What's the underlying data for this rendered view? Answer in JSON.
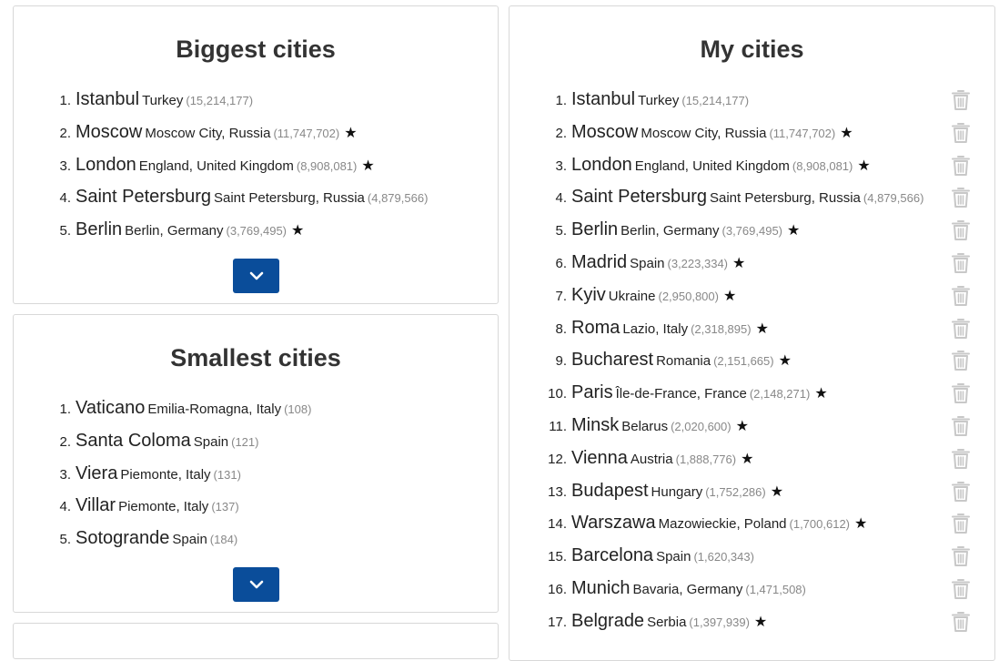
{
  "biggest": {
    "title": "Biggest cities",
    "cities": [
      {
        "num": "1.",
        "name": "Istanbul",
        "region": "Turkey",
        "pop": "(15,214,177)",
        "star": ""
      },
      {
        "num": "2.",
        "name": "Moscow",
        "region": "Moscow City, Russia",
        "pop": "(11,747,702)",
        "star": "★"
      },
      {
        "num": "3.",
        "name": "London",
        "region": "England, United Kingdom",
        "pop": "(8,908,081)",
        "star": "★"
      },
      {
        "num": "4.",
        "name": "Saint Petersburg",
        "region": "Saint Petersburg, Russia",
        "pop": "(4,879,566)",
        "star": ""
      },
      {
        "num": "5.",
        "name": "Berlin",
        "region": "Berlin, Germany",
        "pop": "(3,769,495)",
        "star": "★"
      }
    ],
    "expand_icon": "chevron-down-icon"
  },
  "smallest": {
    "title": "Smallest cities",
    "cities": [
      {
        "num": "1.",
        "name": "Vaticano",
        "region": "Emilia-Romagna, Italy",
        "pop": "(108)",
        "star": ""
      },
      {
        "num": "2.",
        "name": "Santa Coloma",
        "region": "Spain",
        "pop": "(121)",
        "star": ""
      },
      {
        "num": "3.",
        "name": "Viera",
        "region": "Piemonte, Italy",
        "pop": "(131)",
        "star": ""
      },
      {
        "num": "4.",
        "name": "Villar",
        "region": "Piemonte, Italy",
        "pop": "(137)",
        "star": ""
      },
      {
        "num": "5.",
        "name": "Sotogrande",
        "region": "Spain",
        "pop": "(184)",
        "star": ""
      }
    ],
    "expand_icon": "chevron-down-icon"
  },
  "mine": {
    "title": "My cities",
    "cities": [
      {
        "num": "1.",
        "name": "Istanbul",
        "region": "Turkey",
        "pop": "(15,214,177)",
        "star": ""
      },
      {
        "num": "2.",
        "name": "Moscow",
        "region": "Moscow City, Russia",
        "pop": "(11,747,702)",
        "star": "★"
      },
      {
        "num": "3.",
        "name": "London",
        "region": "England, United Kingdom",
        "pop": "(8,908,081)",
        "star": "★"
      },
      {
        "num": "4.",
        "name": "Saint Petersburg",
        "region": "Saint Petersburg, Russia",
        "pop": "(4,879,566)",
        "star": ""
      },
      {
        "num": "5.",
        "name": "Berlin",
        "region": "Berlin, Germany",
        "pop": "(3,769,495)",
        "star": "★"
      },
      {
        "num": "6.",
        "name": "Madrid",
        "region": "Spain",
        "pop": "(3,223,334)",
        "star": "★"
      },
      {
        "num": "7.",
        "name": "Kyiv",
        "region": "Ukraine",
        "pop": "(2,950,800)",
        "star": "★"
      },
      {
        "num": "8.",
        "name": "Roma",
        "region": "Lazio, Italy",
        "pop": "(2,318,895)",
        "star": "★"
      },
      {
        "num": "9.",
        "name": "Bucharest",
        "region": "Romania",
        "pop": "(2,151,665)",
        "star": "★"
      },
      {
        "num": "10.",
        "name": "Paris",
        "region": "Île-de-France, France",
        "pop": "(2,148,271)",
        "star": "★"
      },
      {
        "num": "11.",
        "name": "Minsk",
        "region": "Belarus",
        "pop": "(2,020,600)",
        "star": "★"
      },
      {
        "num": "12.",
        "name": "Vienna",
        "region": "Austria",
        "pop": "(1,888,776)",
        "star": "★"
      },
      {
        "num": "13.",
        "name": "Budapest",
        "region": "Hungary",
        "pop": "(1,752,286)",
        "star": "★"
      },
      {
        "num": "14.",
        "name": "Warszawa",
        "region": "Mazowieckie, Poland",
        "pop": "(1,700,612)",
        "star": "★"
      },
      {
        "num": "15.",
        "name": "Barcelona",
        "region": "Spain",
        "pop": "(1,620,343)",
        "star": ""
      },
      {
        "num": "16.",
        "name": "Munich",
        "region": "Bavaria, Germany",
        "pop": "(1,471,508)",
        "star": ""
      },
      {
        "num": "17.",
        "name": "Belgrade",
        "region": "Serbia",
        "pop": "(1,397,939)",
        "star": "★"
      }
    ],
    "delete_icon": "trash-icon"
  },
  "colors": {
    "button": "#0a4d9a",
    "trash": "#c8c8c8",
    "population": "#888888"
  }
}
